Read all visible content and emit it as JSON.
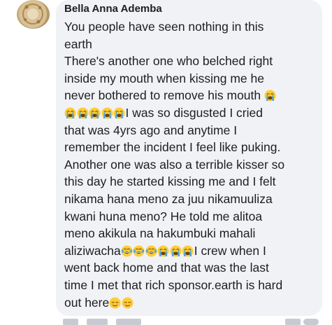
{
  "comment": {
    "author": "Bella Anna Ademba",
    "lines": [
      [
        {
          "t": "You people have seen nothing in this"
        }
      ],
      [
        {
          "t": "earth"
        }
      ],
      [
        {
          "t": "There's another one who belched right"
        }
      ],
      [
        {
          "t": "inside my mouth when kissing me he"
        }
      ],
      [
        {
          "t": "never bothered to remove his mouth "
        },
        {
          "e": "loudly-crying-face-emoji"
        }
      ],
      [
        {
          "e": "loudly-crying-face-emoji"
        },
        {
          "e": "loudly-crying-face-emoji"
        },
        {
          "e": "loudly-crying-face-emoji"
        },
        {
          "e": "loudly-crying-face-emoji"
        },
        {
          "e": "loudly-crying-face-emoji"
        },
        {
          "t": "I was so disgusted I cried"
        }
      ],
      [
        {
          "t": "that was 4yrs ago and anytime I"
        }
      ],
      [
        {
          "t": "remember the incident I feel like puking."
        }
      ],
      [
        {
          "t": "Another one was also a terrible kisser so"
        }
      ],
      [
        {
          "t": "this day he started kissing me and I felt"
        }
      ],
      [
        {
          "t": "nikama hana meno za juu nikamuuliza"
        }
      ],
      [
        {
          "t": "kwani huna meno? He told me alitoa"
        }
      ],
      [
        {
          "t": "meno akikula na hakumbuki mahali"
        }
      ],
      [
        {
          "t": "aliziwacha"
        },
        {
          "e": "face-with-tears-of-joy-emoji"
        },
        {
          "e": "face-with-tears-of-joy-emoji"
        },
        {
          "e": "face-with-tears-of-joy-emoji"
        },
        {
          "e": "loudly-crying-face-emoji"
        },
        {
          "e": "loudly-crying-face-emoji"
        },
        {
          "e": "loudly-crying-face-emoji"
        },
        {
          "t": "I crew when I"
        }
      ],
      [
        {
          "t": "went back home and that was the last"
        }
      ],
      [
        {
          "t": "time I met that rich sponsor.earth is hard"
        }
      ],
      [
        {
          "t": "out here"
        },
        {
          "e": "relieved-face-emoji"
        },
        {
          "e": "relieved-face-emoji"
        }
      ]
    ]
  },
  "colors": {
    "bubble_background": "#f0f2f5",
    "text": "#1c1e21",
    "emoji_yellow": "#ffcc33",
    "emoji_tear_blue": "#4aa3f0"
  }
}
